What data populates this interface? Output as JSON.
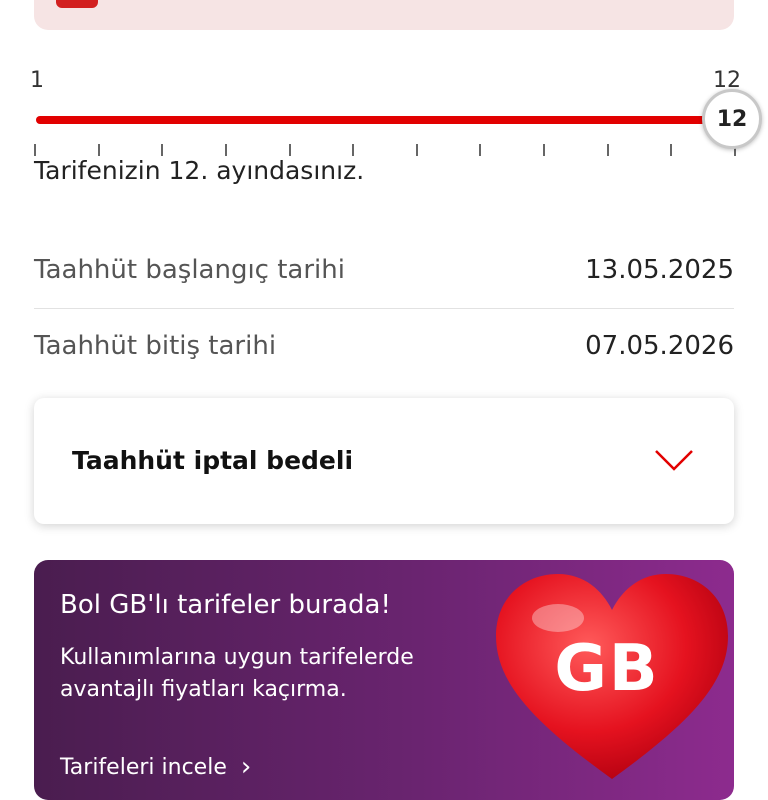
{
  "slider": {
    "min_label": "1",
    "max_label": "12",
    "current_value": "12",
    "fill_fraction": 1.0,
    "status_text": "Tarifenizin 12. ayındasınız."
  },
  "commitment": {
    "start": {
      "label": "Taahhüt başlangıç tarihi",
      "value": "13.05.2025"
    },
    "end": {
      "label": "Taahhüt bitiş tarihi",
      "value": "07.05.2026"
    }
  },
  "accordion": {
    "title": "Taahhüt iptal bedeli",
    "icon": "chevron-down-icon"
  },
  "promo": {
    "title": "Bol GB'lı tarifeler burada!",
    "description": "Kullanımlarına uygun tarifelerde avantajlı fiyatları kaçırma.",
    "link_text": "Tarifeleri incele",
    "badge_text": "GB"
  },
  "colors": {
    "accent": "#e20000",
    "promo_bg": "#6a2470"
  }
}
